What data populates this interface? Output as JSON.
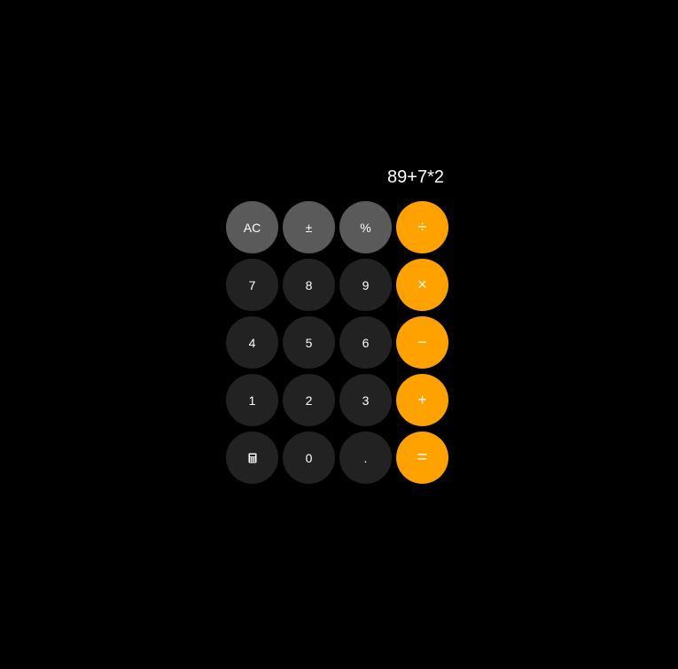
{
  "display": {
    "expression": "89+7*2"
  },
  "keys": {
    "ac": "AC",
    "plus_minus": "±",
    "percent": "%",
    "divide": "÷",
    "seven": "7",
    "eight": "8",
    "nine": "9",
    "multiply": "×",
    "four": "4",
    "five": "5",
    "six": "6",
    "minus": "−",
    "one": "1",
    "two": "2",
    "three": "3",
    "plus": "+",
    "calculator_icon": "calculator-icon",
    "zero": "0",
    "decimal": ".",
    "equals": "="
  },
  "colors": {
    "background": "#000000",
    "function_key": "#5a5a5a",
    "number_key": "#222222",
    "operator_key": "#ffa200",
    "text": "#ffffff"
  }
}
